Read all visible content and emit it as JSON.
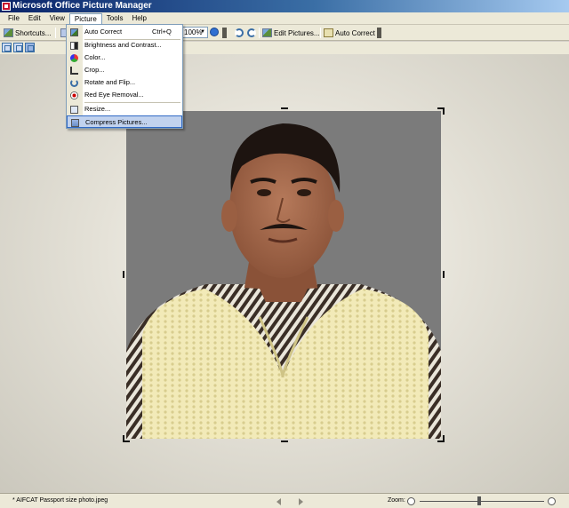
{
  "window": {
    "title": "Microsoft Office Picture Manager"
  },
  "menubar": {
    "items": [
      {
        "label": "File"
      },
      {
        "label": "Edit"
      },
      {
        "label": "View"
      },
      {
        "label": "Picture"
      },
      {
        "label": "Tools"
      },
      {
        "label": "Help"
      }
    ],
    "open_menu": "Picture"
  },
  "toolbar": {
    "shortcuts_label": "Shortcuts...",
    "zoom_value": "100%",
    "edit_pictures_label": "Edit Pictures...",
    "auto_correct_label": "Auto Correct"
  },
  "picture_menu": {
    "items": [
      {
        "label": "Auto Correct",
        "shortcut": "Ctrl+Q",
        "icon": "auto-correct-icon"
      },
      {
        "label": "Brightness and Contrast...",
        "icon": "brightness-icon"
      },
      {
        "label": "Color...",
        "icon": "color-icon"
      },
      {
        "label": "Crop...",
        "icon": "crop-icon"
      },
      {
        "label": "Rotate and Flip...",
        "icon": "rotate-icon"
      },
      {
        "label": "Red Eye Removal...",
        "icon": "red-eye-icon"
      },
      {
        "label": "Resize...",
        "icon": "resize-icon"
      },
      {
        "label": "Compress Pictures...",
        "icon": "compress-icon",
        "highlighted": true
      }
    ]
  },
  "statusbar": {
    "file_name": "* AIFCAT Passport size photo.jpeg",
    "zoom_label": "Zoom:",
    "zoom_level": 0.48
  },
  "colors": {
    "title_bar": "#0a246a",
    "menu_highlight": "#c1d2ee",
    "photo_background": "#7b7b7b",
    "sweater": "#f2eab8"
  }
}
